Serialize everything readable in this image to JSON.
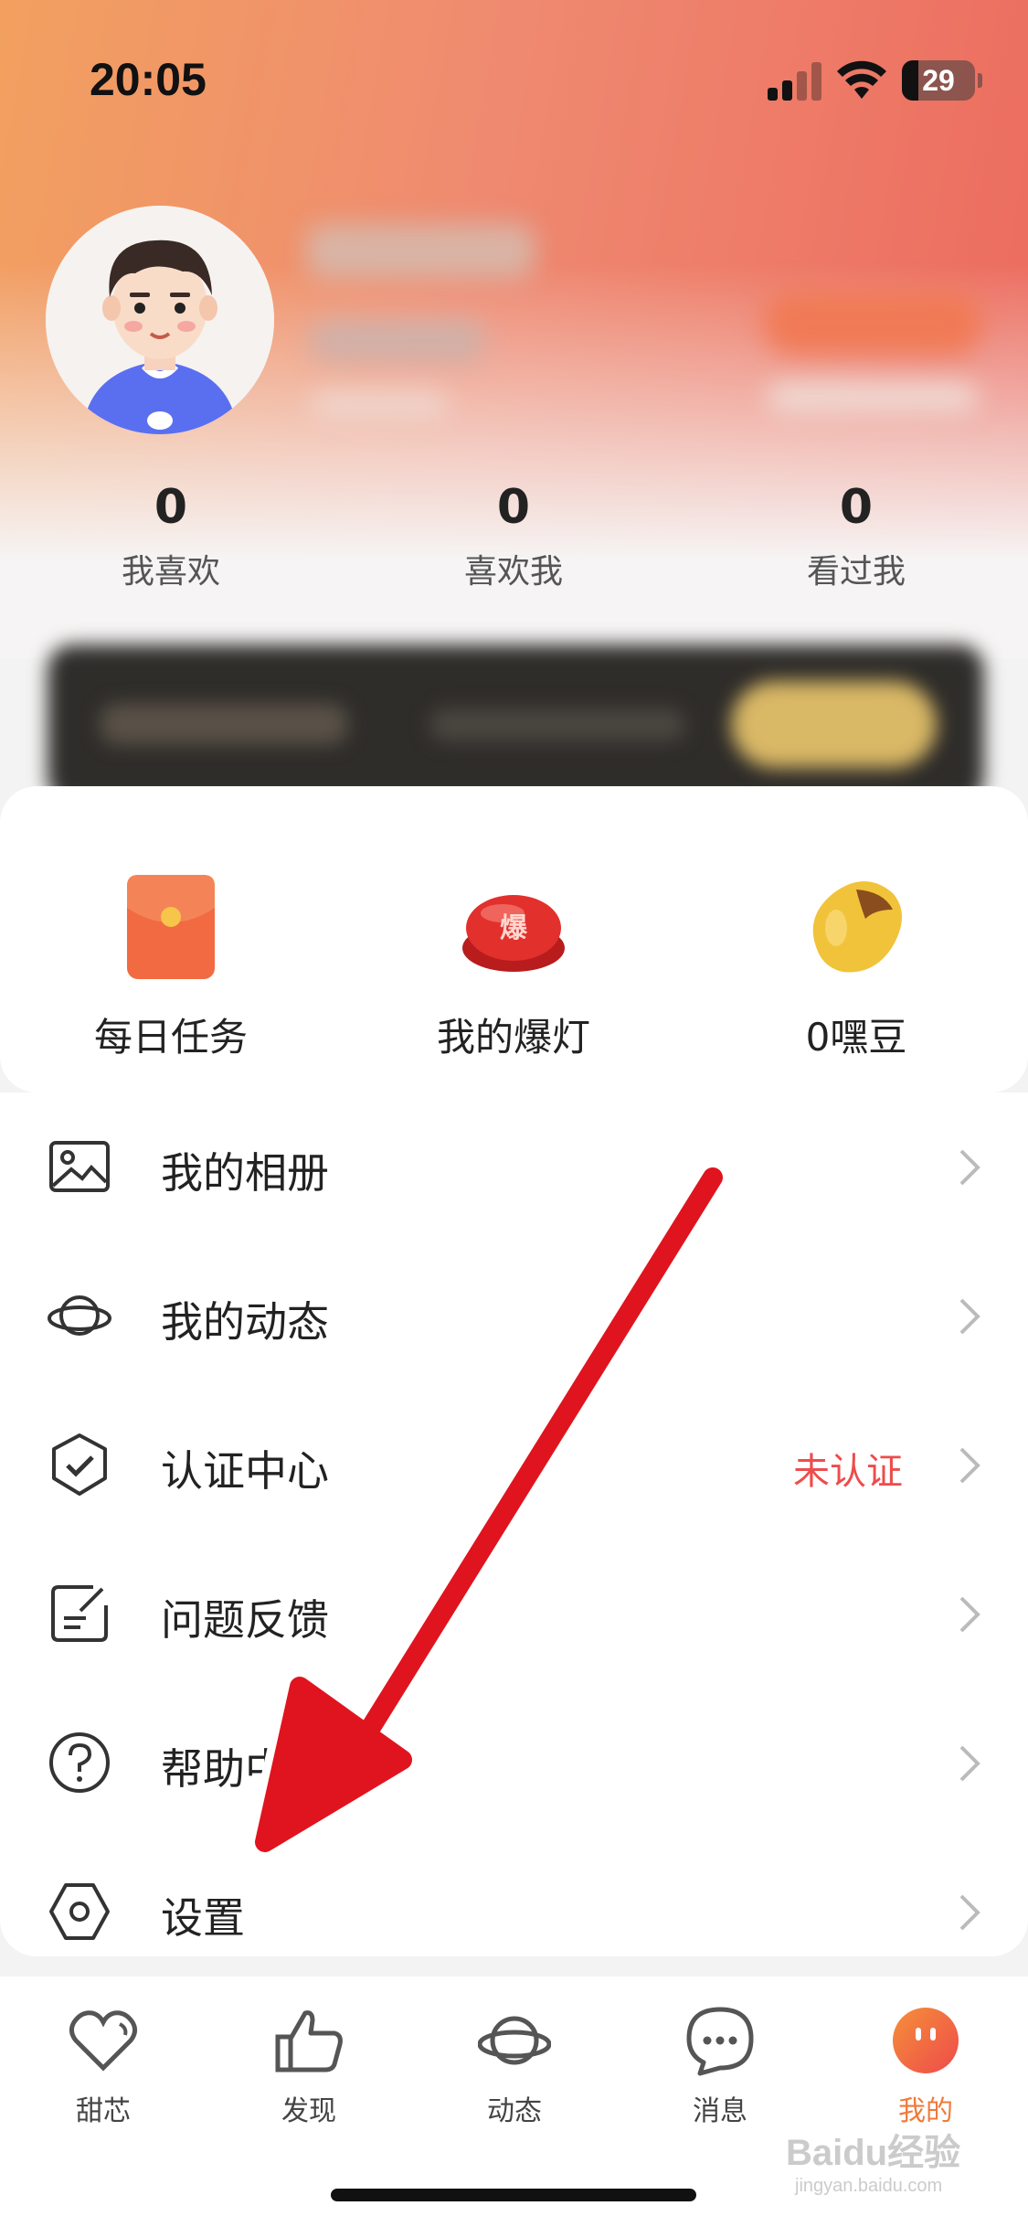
{
  "status_bar": {
    "time": "20:05",
    "battery": "29"
  },
  "profile": {
    "stats": [
      {
        "value": "0",
        "label": "我喜欢"
      },
      {
        "value": "0",
        "label": "喜欢我"
      },
      {
        "value": "0",
        "label": "看过我"
      }
    ]
  },
  "tasks": [
    {
      "label": "每日任务",
      "icon": "red-envelope-icon"
    },
    {
      "label": "我的爆灯",
      "icon": "red-button-icon"
    },
    {
      "label": "0嘿豆",
      "icon": "bean-icon"
    }
  ],
  "menu": {
    "items": [
      {
        "label": "我的相册",
        "icon": "photo-album-icon"
      },
      {
        "label": "我的动态",
        "icon": "planet-icon"
      },
      {
        "label": "认证中心",
        "icon": "verified-badge-icon",
        "status": "未认证"
      },
      {
        "label": "问题反馈",
        "icon": "feedback-note-icon"
      },
      {
        "label": "帮助中",
        "icon": "help-icon"
      },
      {
        "label": "设置",
        "icon": "settings-hexagon-icon"
      }
    ]
  },
  "tabbar": {
    "tabs": [
      {
        "label": "甜芯",
        "icon": "heart-icon"
      },
      {
        "label": "发现",
        "icon": "thumbs-up-icon"
      },
      {
        "label": "动态",
        "icon": "planet-icon"
      },
      {
        "label": "消息",
        "icon": "chat-bubble-icon"
      },
      {
        "label": "我的",
        "icon": "face-icon",
        "active": true
      }
    ]
  },
  "watermark": {
    "brand": "Baidu经验",
    "url": "jingyan.baidu.com"
  },
  "colors": {
    "accent": "#f07a3a",
    "status_red": "#ee4c4c",
    "annotation_arrow": "#e0141e"
  }
}
